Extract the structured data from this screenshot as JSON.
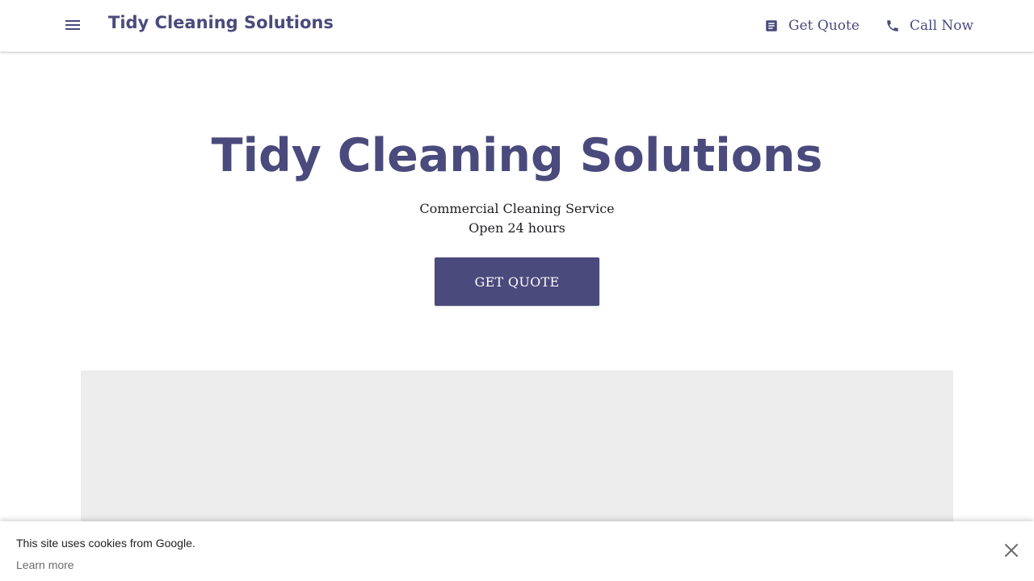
{
  "colors": {
    "brand": "#4a4a7d",
    "text": "#202124",
    "placeholder": "#ededed"
  },
  "header": {
    "brand": "Tidy Cleaning Solutions",
    "menu_icon": "hamburger-menu-icon",
    "actions": [
      {
        "label": "Get Quote",
        "icon": "form-list-icon"
      },
      {
        "label": "Call Now",
        "icon": "phone-icon"
      }
    ]
  },
  "hero": {
    "title": "Tidy Cleaning Solutions",
    "category": "Commercial Cleaning Service",
    "hours": "Open 24 hours",
    "cta_label": "GET QUOTE"
  },
  "cookie_banner": {
    "message": "This site uses cookies from Google.",
    "link": "Learn more",
    "close_icon": "close-icon"
  }
}
